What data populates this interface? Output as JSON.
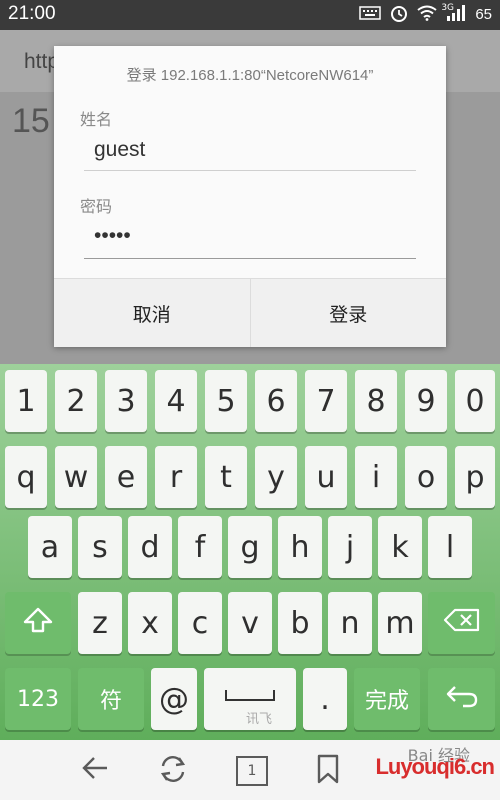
{
  "status_bar": {
    "time": "21:00",
    "signal_label": "3G",
    "battery": "65",
    "icons": [
      "keyboard-icon",
      "alarm-icon",
      "wifi-icon",
      "signal-icon"
    ]
  },
  "browser": {
    "url_fragment": "http",
    "page_text": "15"
  },
  "dialog": {
    "title": "登录 192.168.1.1:80“NetcoreNW614”",
    "username_label": "姓名",
    "username_value": "guest",
    "password_label": "密码",
    "password_value": "•••••",
    "cancel_label": "取消",
    "login_label": "登录"
  },
  "keyboard": {
    "row_numbers": [
      "1",
      "2",
      "3",
      "4",
      "5",
      "6",
      "7",
      "8",
      "9",
      "0"
    ],
    "row_top": [
      "q",
      "w",
      "e",
      "r",
      "t",
      "y",
      "u",
      "i",
      "o",
      "p"
    ],
    "row_middle": [
      "a",
      "s",
      "d",
      "f",
      "g",
      "h",
      "j",
      "k",
      "l"
    ],
    "row_bottom": [
      "z",
      "x",
      "c",
      "v",
      "b",
      "n",
      "m"
    ],
    "shift_icon": "shift-icon",
    "backspace_icon": "backspace-icon",
    "num_label": "123",
    "symbol_label": "符",
    "at_label": "@",
    "space_label": "讯飞",
    "period_label": ".",
    "done_label": "完成",
    "enter_icon": "enter-icon"
  },
  "nav_bar": {
    "back_icon": "back-arrow-icon",
    "refresh_icon": "refresh-icon",
    "tabs_count": "1",
    "bookmark_icon": "bookmark-icon",
    "watermark_top": "Bai 经验",
    "watermark": "Luyouqi6.cn"
  },
  "colors": {
    "keyboard_top": "#9ed19b",
    "keyboard_bottom": "#5fae5b",
    "function_key": "#6fbc6c"
  }
}
